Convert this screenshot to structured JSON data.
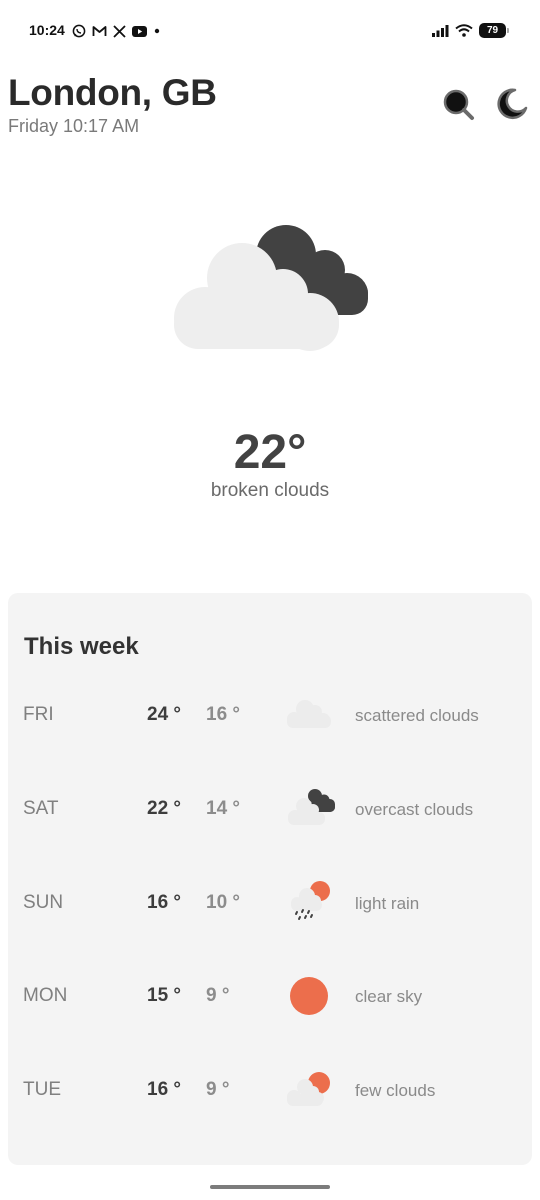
{
  "status_bar": {
    "time": "10:24",
    "notification_icons": [
      "whatsapp-icon",
      "gmail-icon",
      "x-icon",
      "youtube-icon",
      "dot-icon"
    ],
    "signal_icon": "signal-icon",
    "wifi_icon": "wifi-icon",
    "battery": "79"
  },
  "header": {
    "city": "London, GB",
    "datetime": "Friday 10:17 AM",
    "search_icon": "search-icon",
    "theme_icon": "moon-icon"
  },
  "current": {
    "icon": "broken-clouds-icon",
    "temperature": "22°",
    "description": "broken clouds"
  },
  "week": {
    "title": "This week",
    "days": [
      {
        "day": "FRI",
        "high": "24 °",
        "low": "16 °",
        "icon": "scattered-clouds-icon",
        "description": "scattered clouds"
      },
      {
        "day": "SAT",
        "high": "22 °",
        "low": "14 °",
        "icon": "overcast-clouds-icon",
        "description": "overcast clouds"
      },
      {
        "day": "SUN",
        "high": "16 °",
        "low": "10 °",
        "icon": "light-rain-icon",
        "description": "light rain"
      },
      {
        "day": "MON",
        "high": "15 °",
        "low": "9 °",
        "icon": "clear-sky-icon",
        "description": "clear sky"
      },
      {
        "day": "TUE",
        "high": "16 °",
        "low": "9 °",
        "icon": "few-clouds-icon",
        "description": "few clouds"
      }
    ]
  },
  "colors": {
    "sun": "#ec6e4c",
    "light_cloud": "#eeeeee",
    "dark_cloud": "#424242",
    "card_background": "#f4f4f4"
  }
}
